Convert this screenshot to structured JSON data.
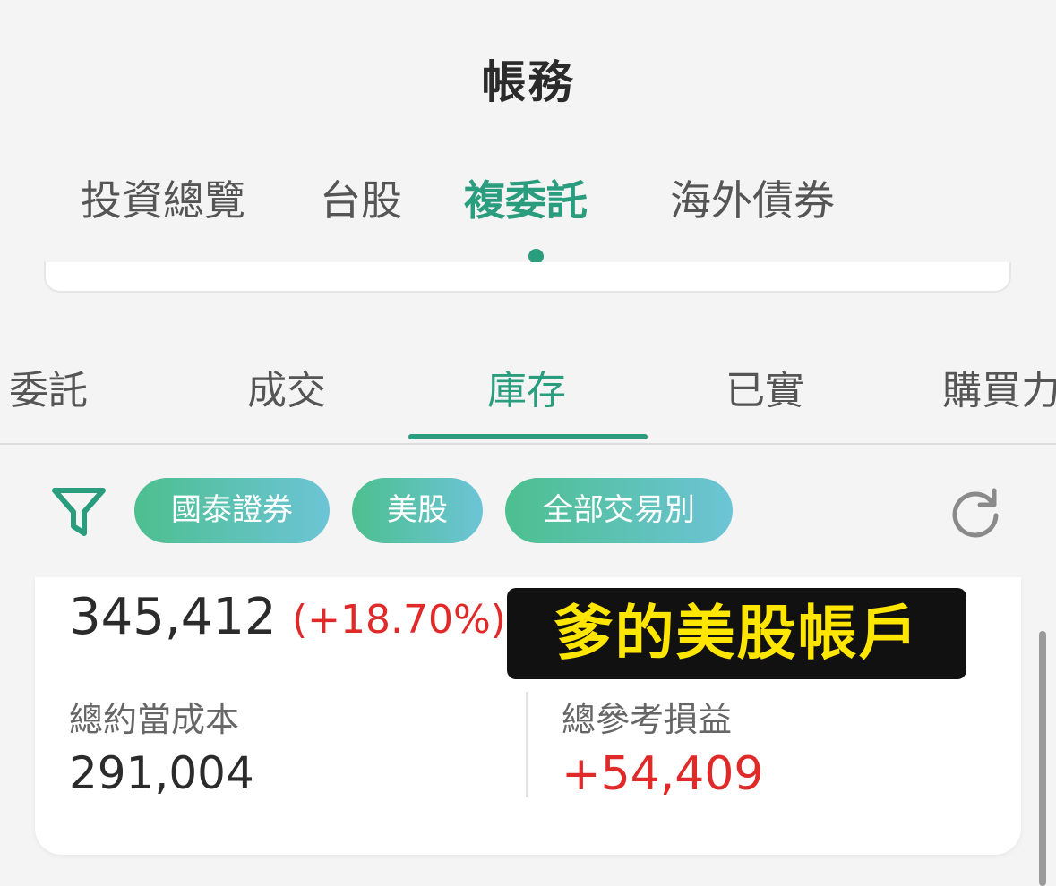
{
  "header": {
    "title": "帳務"
  },
  "main_tabs": [
    {
      "label": "投資總覽",
      "active": false
    },
    {
      "label": "台股",
      "active": false
    },
    {
      "label": "複委託",
      "active": true
    },
    {
      "label": "海外債券",
      "active": false
    }
  ],
  "sub_tabs": [
    {
      "label": "委託",
      "active": false
    },
    {
      "label": "成交",
      "active": false
    },
    {
      "label": "庫存",
      "active": true
    },
    {
      "label": "已實",
      "active": false
    },
    {
      "label": "購買力",
      "active": false
    }
  ],
  "filters": {
    "filter_icon": "filter-icon",
    "chips": [
      "國泰證券",
      "美股",
      "全部交易別"
    ],
    "refresh_icon": "refresh-icon"
  },
  "summary": {
    "market_value": "345,412",
    "return_pct": "(+18.70%)",
    "overlay_text": "爹的美股帳戶",
    "cost_label": "總約當成本",
    "cost_value": "291,004",
    "pl_label": "總參考損益",
    "pl_value": "+54,409"
  },
  "colors": {
    "accent": "#2a9d7f",
    "positive": "#e02a2a",
    "overlay_bg": "#111111",
    "overlay_text": "#ffe600"
  }
}
